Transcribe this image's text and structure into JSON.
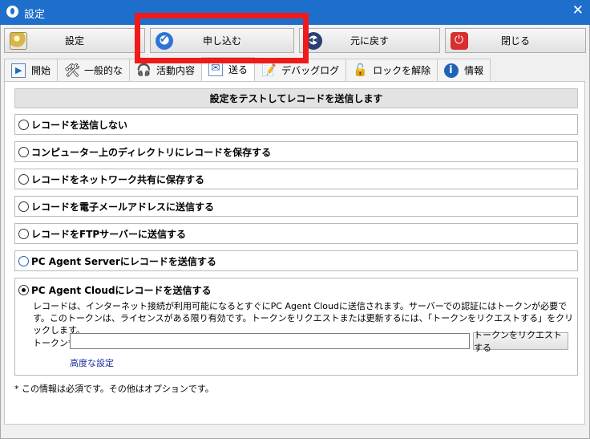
{
  "window": {
    "title": "設定",
    "close_glyph": "✕"
  },
  "toolbar": {
    "settings_label": "設定",
    "apply_label": "申し込む",
    "revert_label": "元に戻す",
    "close_label": "閉じる"
  },
  "tabs": [
    {
      "label": "開始",
      "icon": "play-icon"
    },
    {
      "label": "一般的な",
      "icon": "tools-icon"
    },
    {
      "label": "活動内容",
      "icon": "activity-icon"
    },
    {
      "label": "送る",
      "icon": "send-icon"
    },
    {
      "label": "デバッグログ",
      "icon": "debug-icon"
    },
    {
      "label": "ロックを解除",
      "icon": "lock-icon"
    },
    {
      "label": "情報",
      "icon": "info-icon"
    }
  ],
  "panel": {
    "header": "設定をテストしてレコードを送信します",
    "options": [
      "レコードを送信しない",
      "コンピューター上のディレクトリにレコードを保存する",
      "レコードをネットワーク共有に保存する",
      "レコードを電子メールアドレスに送信する",
      "レコードをFTPサーバーに送信する",
      "PC Agent Serverにレコードを送信する"
    ],
    "cloud": {
      "title": "PC Agent Cloudにレコードを送信する",
      "description": "レコードは、インターネット接続が利用可能になるとすぐにPC Agent Cloudに送信されます。サーバーでの認証にはトークンが必要です。このトークンは、ライセンスがある限り有効です。トークンをリクエストまたは更新するには、「トークンをリクエストする」をクリックします。",
      "token_label": "トークン*:",
      "token_value": "",
      "request_button": "トークンをリクエストする",
      "advanced_link": "高度な設定"
    },
    "footnote": "* この情報は必須です。その他はオプションです。"
  },
  "colors": {
    "titlebar": "#1e6fcc",
    "highlight": "#ef1a1a",
    "link": "#1a2d9a"
  }
}
